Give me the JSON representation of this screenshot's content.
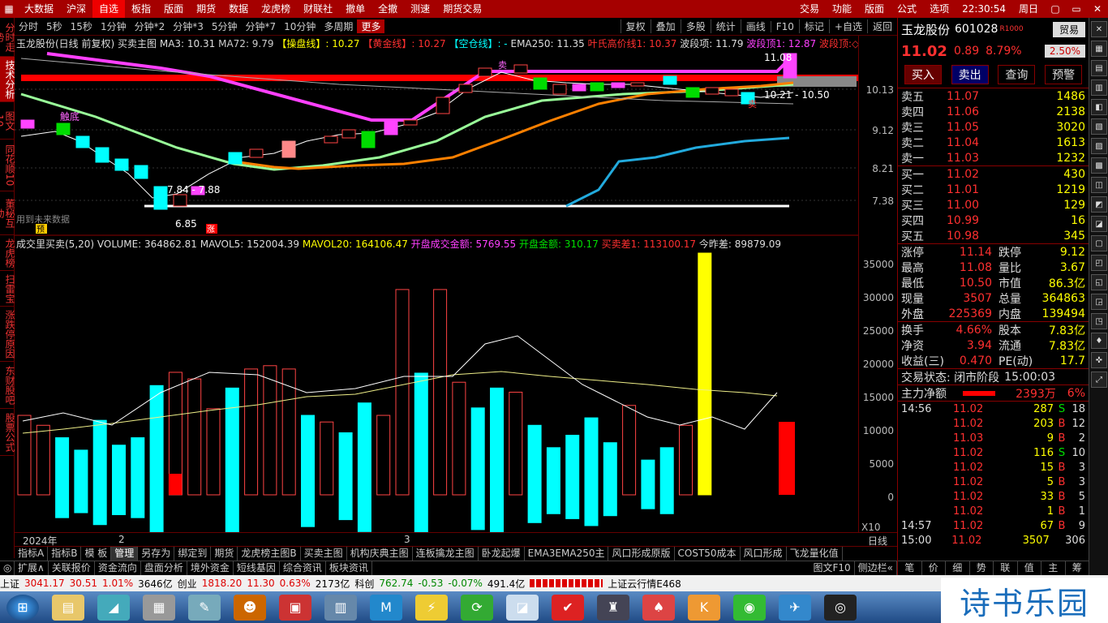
{
  "menubar": {
    "items": [
      "大数据",
      "沪深",
      "自选",
      "板指",
      "版面",
      "期货",
      "数据",
      "龙虎榜",
      "财联社",
      "撤单",
      "全撤",
      "测速",
      "期货交易"
    ],
    "right": [
      "交易",
      "功能",
      "版面",
      "公式",
      "选项"
    ],
    "time": "22:30:54",
    "weekday": "周日"
  },
  "lefttabs": [
    "分时走势",
    "技术分析",
    "图文10",
    "同花顺10",
    "董秘互动",
    "龙虎榜",
    "扫雷宝",
    "涨跌停原因",
    "东财股吧",
    "股票公式"
  ],
  "toolbar": {
    "left": [
      "分时",
      "5秒",
      "15秒",
      "1分钟",
      "分钟*2",
      "分钟*3",
      "5分钟",
      "分钟*7",
      "10分钟",
      "多周期",
      "更多"
    ],
    "right": [
      "复权",
      "叠加",
      "多股",
      "统计",
      "画线",
      "F10",
      "标记",
      "+自选",
      "返回"
    ]
  },
  "main_info": {
    "stock": "玉龙股份(日线 前复权)",
    "indicator": "买卖主图",
    "ma3": "MA3: 10.31",
    "ma72": "MA72: 9.79",
    "caopan": "【操盘线】: 10.27",
    "huangjin": "【黄金线】: 10.27",
    "kongqi": "【空仓线】: -",
    "ema250": "EMA250: 11.35",
    "yeshi": "叶氏高价线1: 10.37",
    "boduan": "波段项: 11.79",
    "boduan1": "波段顶1: 12.87",
    "boduan2": "波段顶:◇"
  },
  "main_chart": {
    "labels": {
      "high": "11.08",
      "range": "10.21 - 10.50",
      "low_range": "7.84 - 7.88",
      "low": "6.85",
      "future": "用到未来数据",
      "zhang": "涨",
      "yu": "预",
      "buy1": "卖",
      "buy2": "卖",
      "dixia": "触底"
    },
    "yaxis": [
      "10.13",
      "9.12",
      "8.21",
      "7.38"
    ]
  },
  "vol_info": {
    "title": "成交里买卖(5,20)",
    "volume": "VOLUME: 364862.81",
    "mavol5": "MAVOL5: 152004.39",
    "mavol20": "MAVOL20: 164106.47",
    "kaipan": "开盘成交金额: 5769.55",
    "kaipanjine": "开盘金额: 310.17",
    "maimaicha": "买卖差1: 113100.17",
    "jinzuocha": "今昨差: 89879.09"
  },
  "vol_yaxis": [
    "35000",
    "30000",
    "25000",
    "20000",
    "15000",
    "10000",
    "5000",
    "0"
  ],
  "chart_data": {
    "type": "bar",
    "title": "成交里买卖(5,20)",
    "x_axis_labels": [
      "2024年",
      "2",
      "3"
    ],
    "ylim": [
      0,
      37000
    ],
    "series": [
      {
        "name": "VOLUME",
        "values": [
          12000,
          10500,
          11500,
          9000,
          15000,
          10000,
          11500,
          22000,
          18500,
          17500,
          13000,
          21500,
          19000,
          19500,
          19000,
          16000,
          11000,
          12500,
          18500,
          12000,
          31000,
          24500,
          31000,
          17000,
          17500,
          21500,
          15500,
          14000,
          9500,
          12000,
          15500,
          10500,
          13500,
          7000,
          9500,
          10500,
          36500
        ]
      }
    ]
  },
  "xaxis": {
    "labels": [
      "2024年",
      "2",
      "3"
    ],
    "right": "X10",
    "period": "日线"
  },
  "tabs": [
    "指标A",
    "指标B",
    "模 板",
    "管理",
    "另存为",
    "绑定到",
    "期货",
    "龙虎榜主图B",
    "买卖主图",
    "机构庆典主图",
    "连板擒龙主图",
    "卧龙起爆",
    "EMA3EMA250主",
    "风口形成原版",
    "COST50成本",
    "风口形成",
    "飞龙量化值"
  ],
  "subtabs": [
    "扩展∧",
    "关联报价",
    "资金流向",
    "盘面分析",
    "境外资金",
    "短线基因",
    "综合资讯",
    "板块资讯"
  ],
  "subtabs_right": [
    "图文F10",
    "侧边栏«"
  ],
  "rpanel": {
    "name": "玉龙股份",
    "code": "601028",
    "tag": "R1000",
    "price": "11.02",
    "chg": "0.89",
    "pct": "8.79%",
    "trade_btn": "贸易",
    "rate": "2.50%",
    "btns": [
      "买入",
      "卖出",
      "查询",
      "预警"
    ],
    "sells": [
      {
        "l": "卖五",
        "p": "11.07",
        "v": "1486"
      },
      {
        "l": "卖四",
        "p": "11.06",
        "v": "2138"
      },
      {
        "l": "卖三",
        "p": "11.05",
        "v": "3020"
      },
      {
        "l": "卖二",
        "p": "11.04",
        "v": "1613"
      },
      {
        "l": "卖一",
        "p": "11.03",
        "v": "1232"
      }
    ],
    "buys": [
      {
        "l": "买一",
        "p": "11.02",
        "v": "430"
      },
      {
        "l": "买二",
        "p": "11.01",
        "v": "1219"
      },
      {
        "l": "买三",
        "p": "11.00",
        "v": "129"
      },
      {
        "l": "买四",
        "p": "10.99",
        "v": "16"
      },
      {
        "l": "买五",
        "p": "10.98",
        "v": "345"
      }
    ],
    "stats": [
      {
        "a": "涨停",
        "b": "11.14",
        "c": "跌停",
        "d": "9.12"
      },
      {
        "a": "最高",
        "b": "11.08",
        "c": "量比",
        "d": "3.67"
      },
      {
        "a": "最低",
        "b": "10.50",
        "c": "市值",
        "d": "86.3亿"
      },
      {
        "a": "现量",
        "b": "3507",
        "c": "总量",
        "d": "364863"
      },
      {
        "a": "外盘",
        "b": "225369",
        "c": "内盘",
        "d": "139494"
      }
    ],
    "stats2": [
      {
        "a": "换手",
        "b": "4.66%",
        "c": "股本",
        "d": "7.83亿"
      },
      {
        "a": "净资",
        "b": "3.94",
        "c": "流通",
        "d": "7.83亿"
      },
      {
        "a": "收益(三)",
        "b": "0.470",
        "c": "PE(动)",
        "d": "17.7"
      }
    ],
    "status_label": "交易状态: 闭市阶段",
    "status_time": "15:00:03",
    "zhuli_label": "主力净额",
    "zhuli_val": "2393万",
    "zhuli_pct": "6%",
    "ticks": [
      {
        "t": "14:56",
        "p": "11.02",
        "v": "287",
        "s": "S",
        "n": "18"
      },
      {
        "t": "",
        "p": "11.02",
        "v": "203",
        "s": "B",
        "n": "12"
      },
      {
        "t": "",
        "p": "11.03",
        "v": "9",
        "s": "B",
        "n": "2"
      },
      {
        "t": "",
        "p": "11.02",
        "v": "116",
        "s": "S",
        "n": "10"
      },
      {
        "t": "",
        "p": "11.02",
        "v": "15",
        "s": "B",
        "n": "3"
      },
      {
        "t": "",
        "p": "11.02",
        "v": "5",
        "s": "B",
        "n": "3"
      },
      {
        "t": "",
        "p": "11.02",
        "v": "33",
        "s": "B",
        "n": "5"
      },
      {
        "t": "",
        "p": "11.02",
        "v": "1",
        "s": "B",
        "n": "1"
      },
      {
        "t": "14:57",
        "p": "11.02",
        "v": "67",
        "s": "B",
        "n": "9"
      },
      {
        "t": "15:00",
        "p": "11.02",
        "v": "3507",
        "s": "",
        "n": "306"
      }
    ],
    "bottom_tabs": [
      "笔",
      "价",
      "细",
      "势",
      "联",
      "值",
      "主",
      "筹"
    ]
  },
  "statusbar": {
    "sh": "上证",
    "sh_val": "3041.17",
    "sh_chg": "30.51",
    "sh_pct": "1.01%",
    "sh_amt": "3646亿",
    "cy": "创业",
    "cy_val": "1818.20",
    "cy_chg": "11.30",
    "cy_pct": "0.63%",
    "cy_amt": "2173亿",
    "kc": "科创",
    "kc_val": "762.74",
    "kc_chg": "-0.53",
    "kc_pct": "-0.07%",
    "kc_amt": "491.4亿",
    "news": "上证云行情E468"
  },
  "watermark": "诗书乐园"
}
